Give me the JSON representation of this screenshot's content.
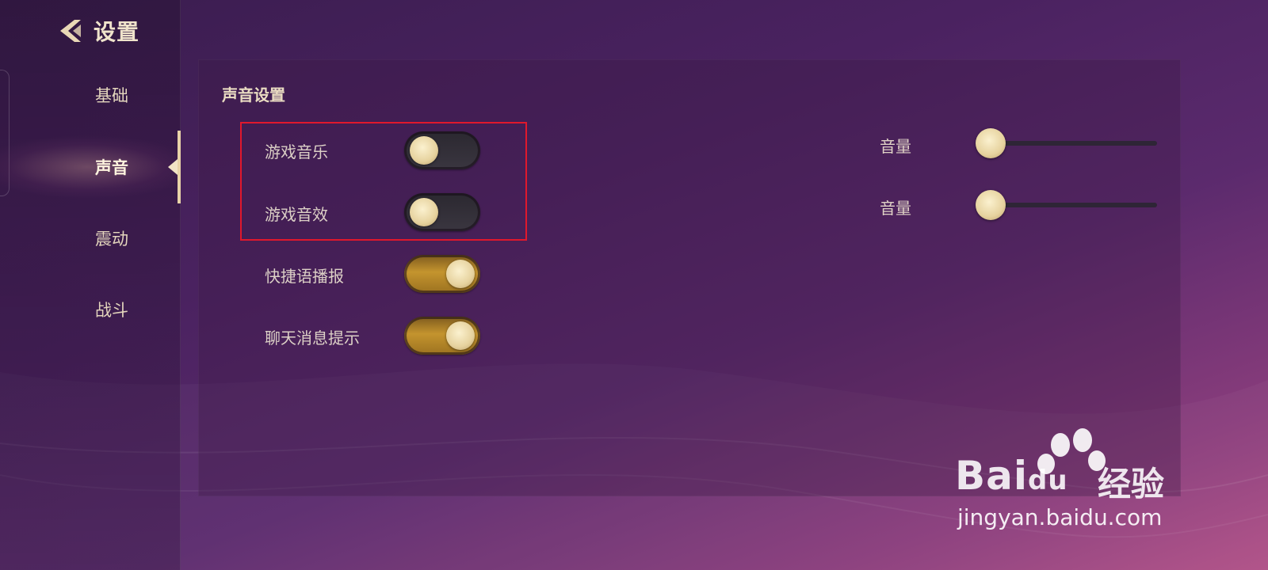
{
  "header": {
    "back_label": "设置"
  },
  "sidebar": {
    "items": [
      {
        "label": "基础",
        "active": false
      },
      {
        "label": "声音",
        "active": true
      },
      {
        "label": "震动",
        "active": false
      },
      {
        "label": "战斗",
        "active": false
      }
    ]
  },
  "sound_settings": {
    "title": "声音设置",
    "toggles": [
      {
        "label": "游戏音乐",
        "on": false
      },
      {
        "label": "游戏音效",
        "on": false
      },
      {
        "label": "快捷语播报",
        "on": true
      },
      {
        "label": "聊天消息提示",
        "on": true
      }
    ],
    "volumes": [
      {
        "label": "音量",
        "value": 0
      },
      {
        "label": "音量",
        "value": 0
      }
    ]
  },
  "watermark": {
    "brand": "Bai",
    "brand_suffix": "du",
    "cn": "经验",
    "url": "jingyan.baidu.com"
  },
  "colors": {
    "accent_gold": "#c4942e",
    "highlight_red": "#e0182c",
    "knob": "#e6d29e"
  }
}
